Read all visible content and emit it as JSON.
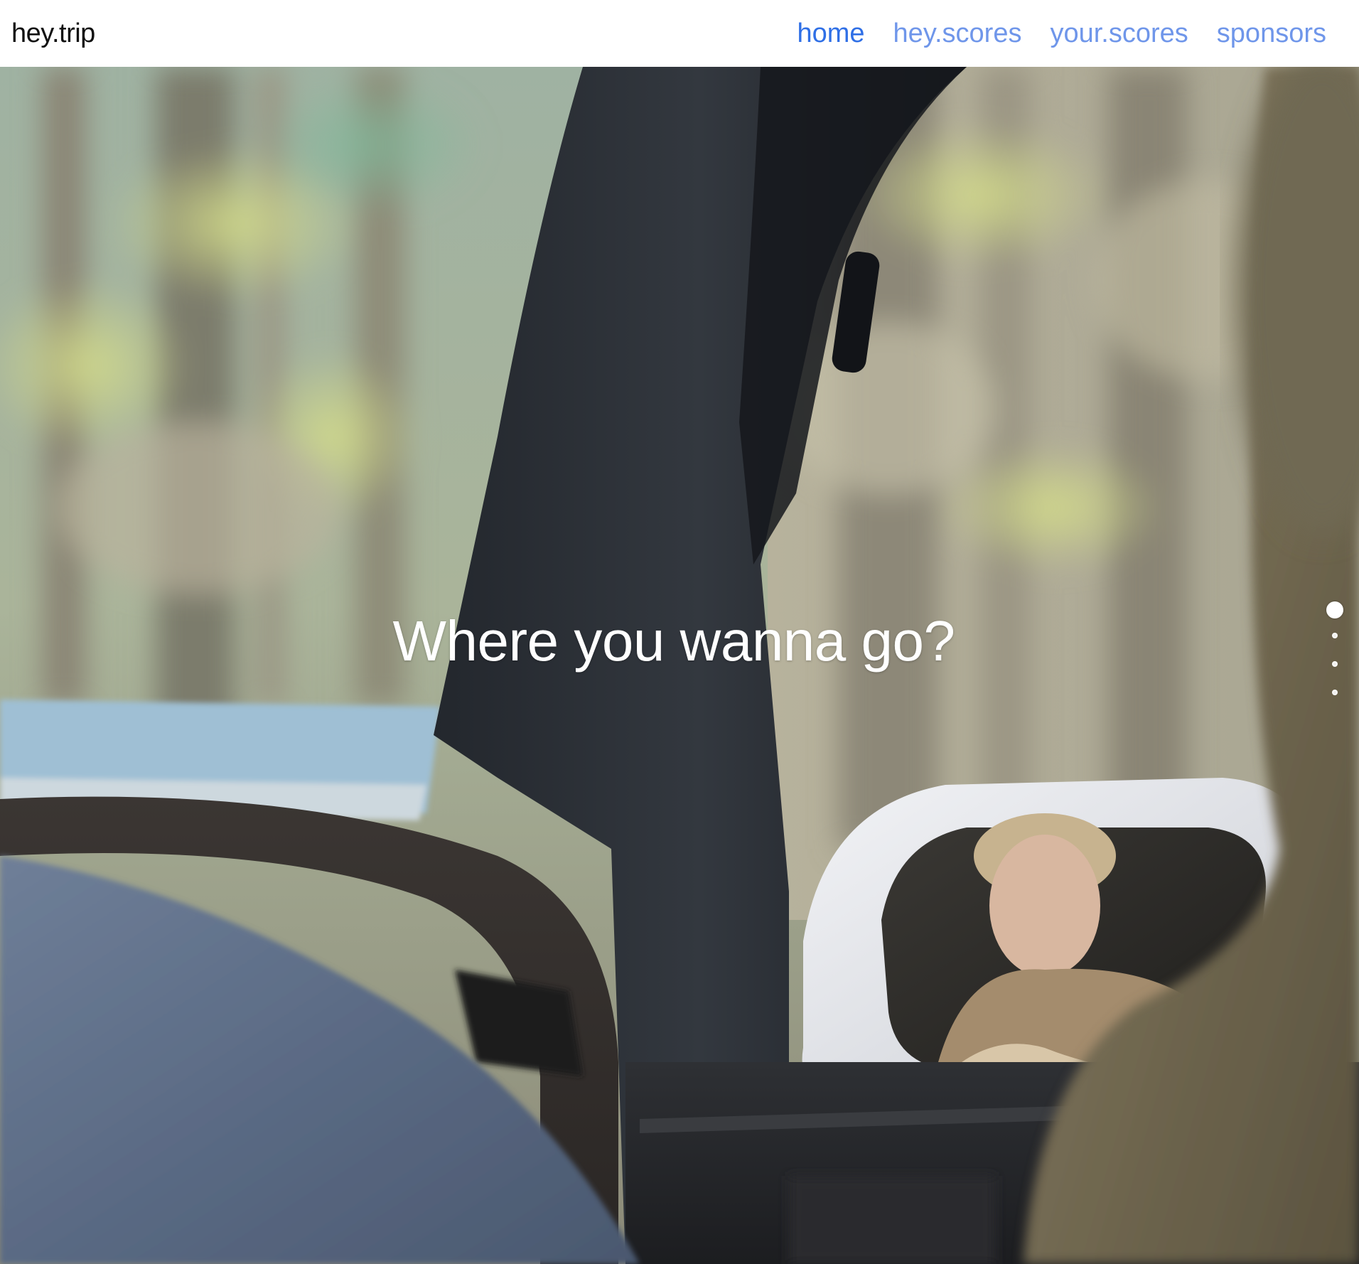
{
  "brand": {
    "name": "hey.trip"
  },
  "nav": {
    "items": [
      {
        "label": "home",
        "active": true
      },
      {
        "label": "hey.scores",
        "active": false
      },
      {
        "label": "your.scores",
        "active": false
      },
      {
        "label": "sponsors",
        "active": false
      }
    ]
  },
  "hero": {
    "headline": "Where you wanna go?",
    "background_description_icon": "car-interior-photo"
  },
  "slider": {
    "count": 4,
    "active_index": 0
  },
  "colors": {
    "nav_active": "#2f6fe6",
    "nav_inactive": "#6f96ea",
    "brand_text": "#111111",
    "headline_text": "#ffffff"
  }
}
